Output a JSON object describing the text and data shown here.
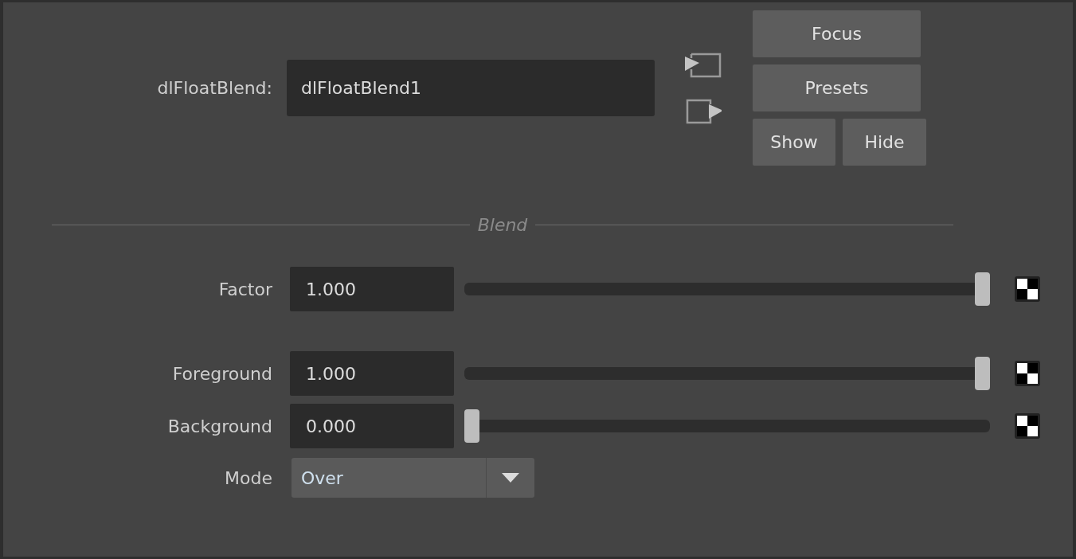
{
  "node": {
    "label": "dlFloatBlend:",
    "value": "dlFloatBlend1"
  },
  "buttons": {
    "focus": "Focus",
    "presets": "Presets",
    "show": "Show",
    "hide": "Hide"
  },
  "section": {
    "title": "Blend"
  },
  "attributes": [
    {
      "kind": "slider",
      "label": "Factor",
      "value": "1.000",
      "level": 1.0
    },
    {
      "kind": "slider",
      "label": "Foreground",
      "value": "1.000",
      "level": 1.0
    },
    {
      "kind": "slider",
      "label": "Background",
      "value": "0.000",
      "level": 0.0
    },
    {
      "kind": "dropdown",
      "label": "Mode",
      "value": "Over"
    }
  ]
}
